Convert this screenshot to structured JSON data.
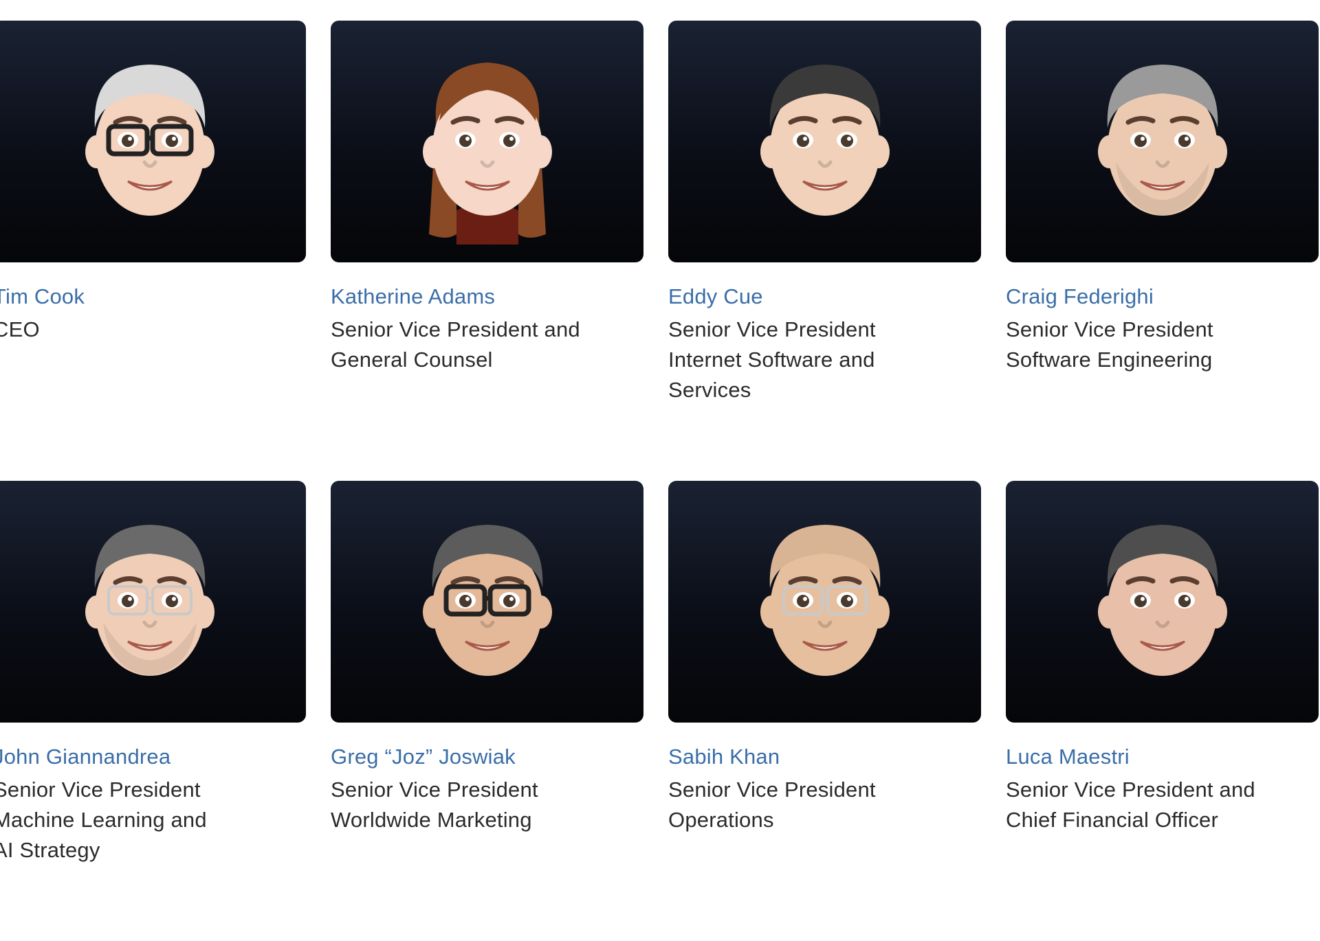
{
  "people": [
    {
      "name": "Tim Cook",
      "title_lines": [
        "CEO"
      ],
      "icon": "memoji-avatar-icon",
      "skin": "#f4d3bf",
      "hair": "#d9d9d9",
      "glasses": "dark",
      "beard": false,
      "long_hair": false
    },
    {
      "name": "Katherine Adams",
      "title_lines": [
        "Senior Vice President and",
        "General Counsel"
      ],
      "icon": "memoji-avatar-icon",
      "skin": "#f6d7c8",
      "hair": "#8a4a25",
      "glasses": "none",
      "beard": false,
      "long_hair": true
    },
    {
      "name": "Eddy Cue",
      "title_lines": [
        "Senior Vice President",
        "Internet Software and",
        "Services"
      ],
      "icon": "memoji-avatar-icon",
      "skin": "#f1d1b9",
      "hair": "#3a3a3a",
      "glasses": "none",
      "beard": false,
      "long_hair": false
    },
    {
      "name": "Craig Federighi",
      "title_lines": [
        "Senior Vice President",
        "Software Engineering"
      ],
      "icon": "memoji-avatar-icon",
      "skin": "#eccab1",
      "hair": "#9a9a9a",
      "glasses": "none",
      "beard": true,
      "long_hair": false
    },
    {
      "name": "John Giannandrea",
      "title_lines": [
        "Senior Vice President",
        "Machine Learning and",
        "AI Strategy"
      ],
      "icon": "memoji-avatar-icon",
      "skin": "#f0cdb7",
      "hair": "#6a6a6a",
      "glasses": "light",
      "beard": true,
      "long_hair": false
    },
    {
      "name": "Greg “Joz” Joswiak",
      "title_lines": [
        "Senior Vice President",
        "Worldwide Marketing"
      ],
      "icon": "memoji-avatar-icon",
      "skin": "#e4b99a",
      "hair": "#5c5c5c",
      "glasses": "dark",
      "beard": false,
      "long_hair": false
    },
    {
      "name": "Sabih Khan",
      "title_lines": [
        "Senior Vice President",
        "Operations"
      ],
      "icon": "memoji-avatar-icon",
      "skin": "#e6bf9f",
      "hair": "#d9b494",
      "glasses": "light",
      "beard": false,
      "long_hair": false
    },
    {
      "name": "Luca Maestri",
      "title_lines": [
        "Senior Vice President and",
        "Chief Financial Officer"
      ],
      "icon": "memoji-avatar-icon",
      "skin": "#e8bfa8",
      "hair": "#4e4e4e",
      "glasses": "none",
      "beard": false,
      "long_hair": false
    }
  ]
}
